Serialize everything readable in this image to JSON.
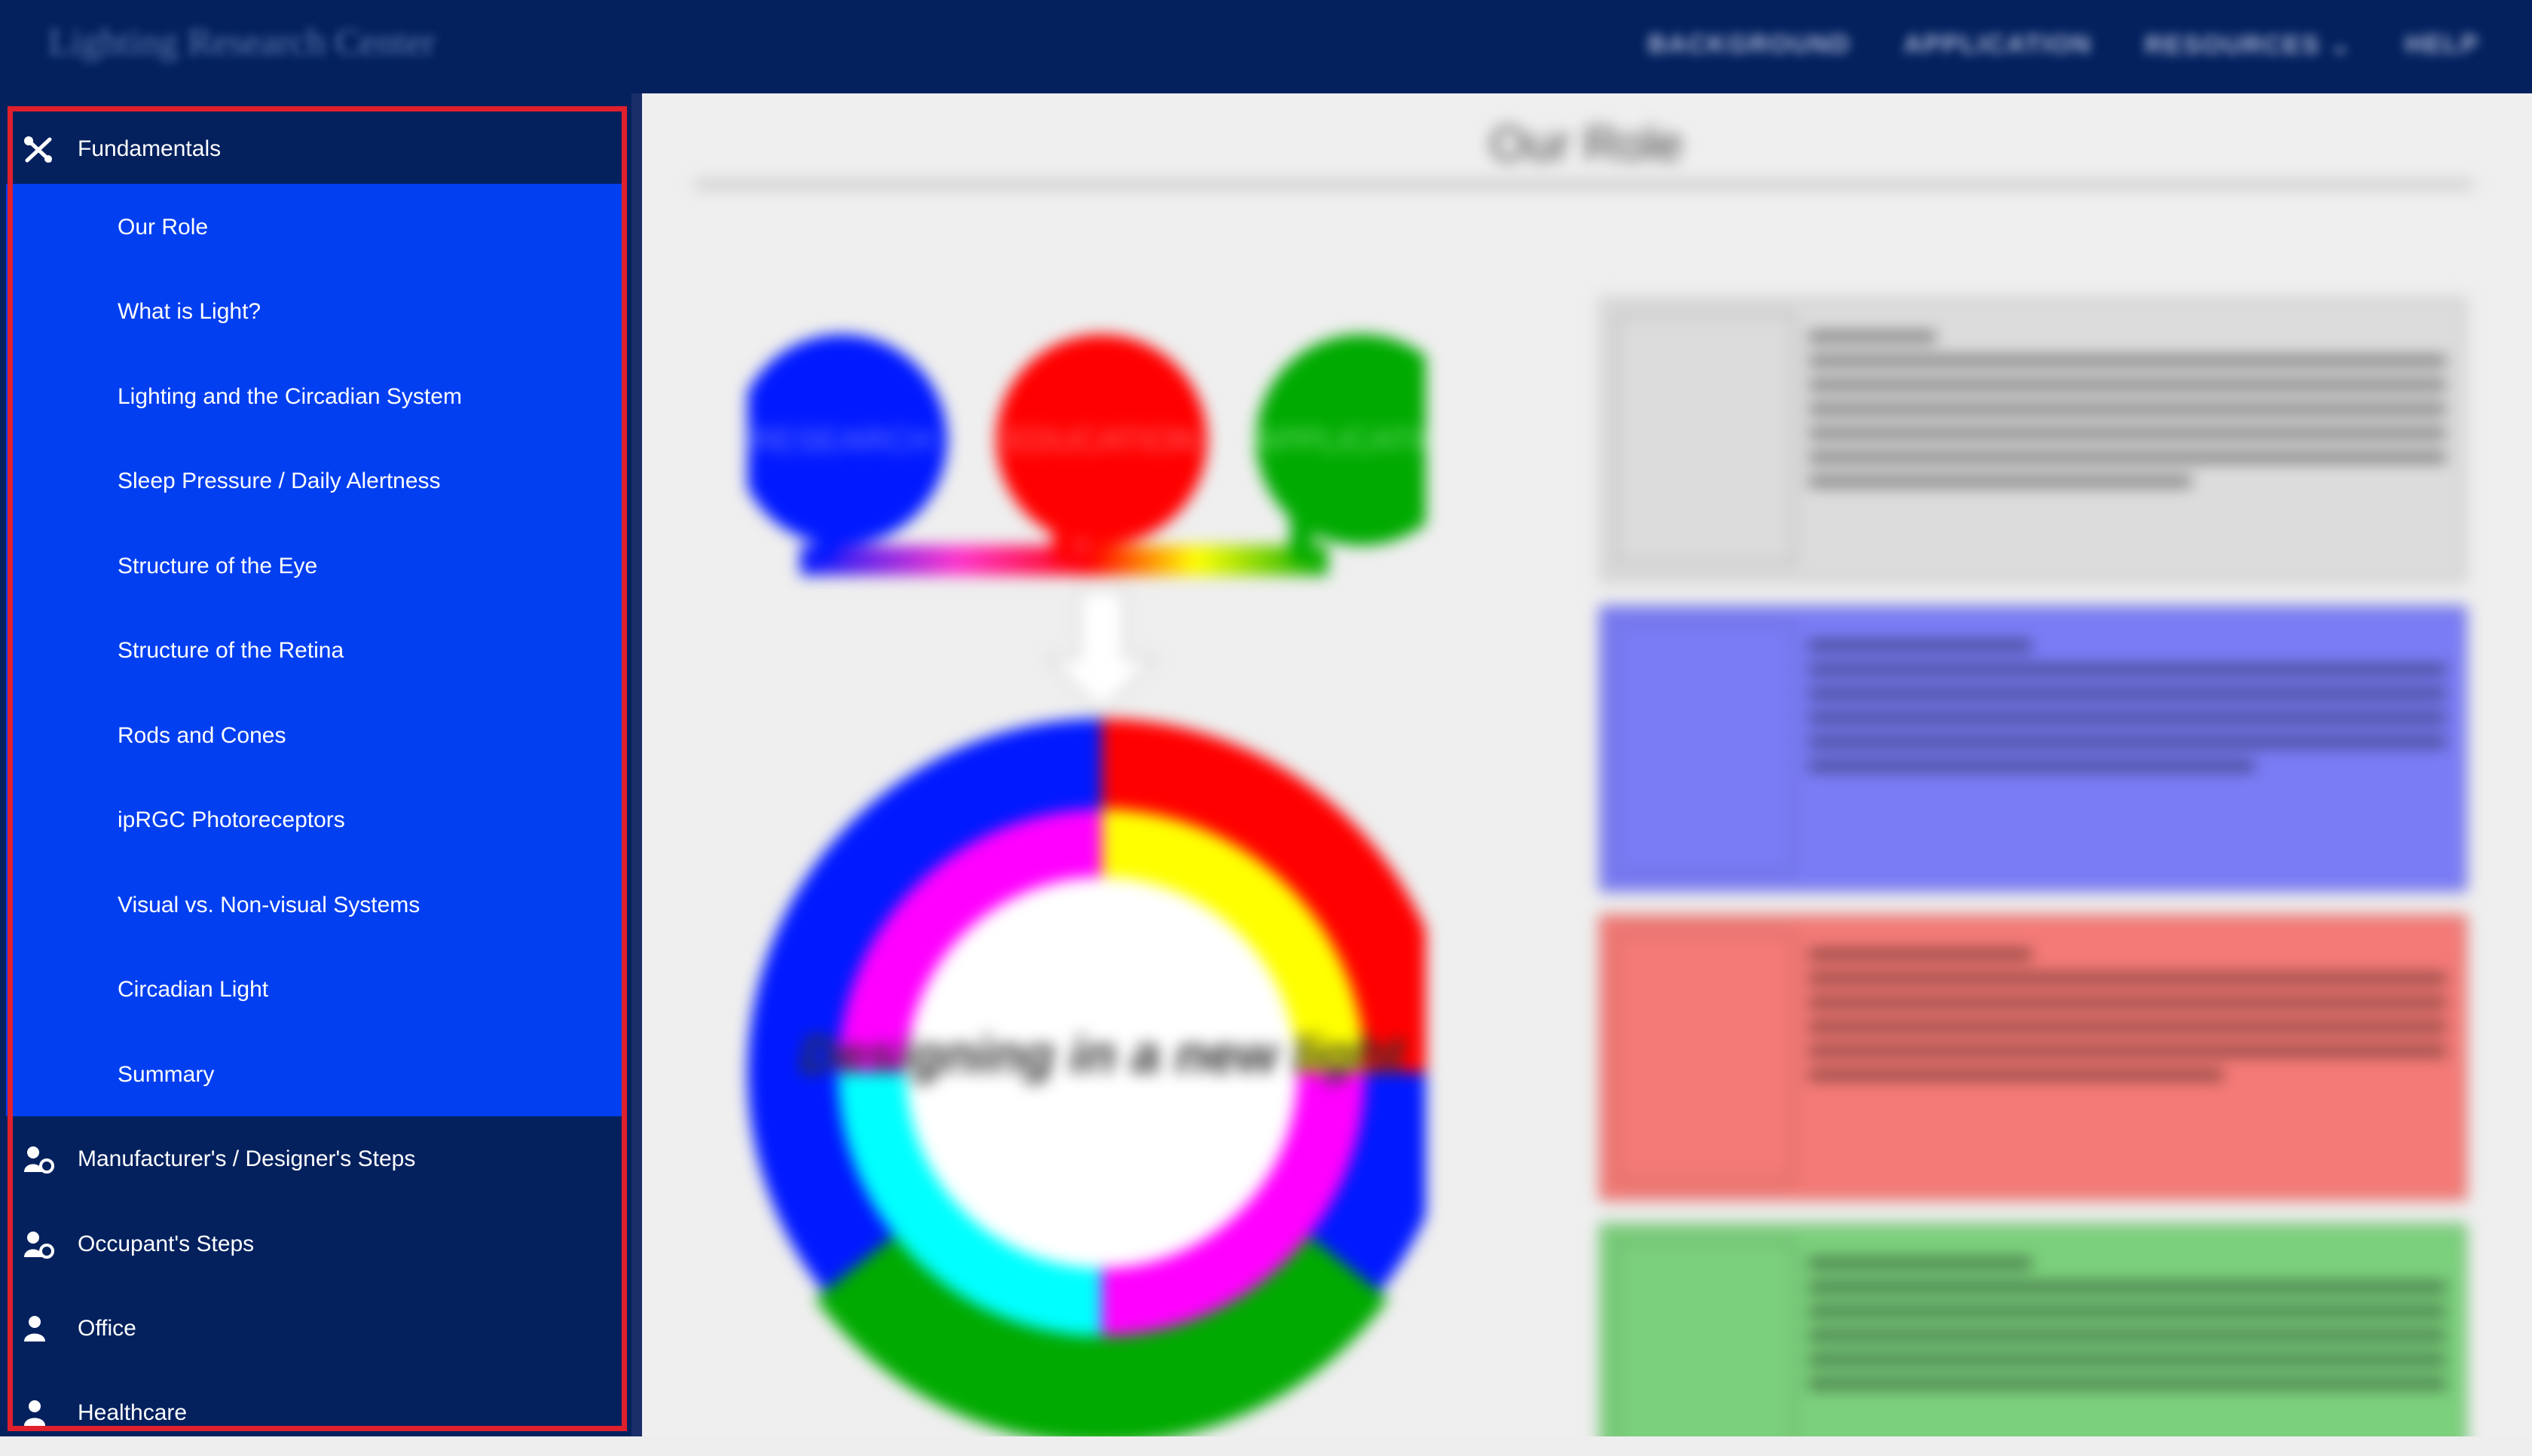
{
  "header": {
    "brand": "Lighting Research Center",
    "nav": [
      "BACKGROUND",
      "APPLICATION",
      "RESOURCES ⌄",
      "HELP"
    ]
  },
  "sidebar": {
    "sections": [
      {
        "label": "Fundamentals",
        "icon": "tools-icon"
      },
      {
        "label": "Manufacturer's / Designer's Steps",
        "icon": "user-settings-icon"
      },
      {
        "label": "Occupant's Steps",
        "icon": "user-settings-icon"
      },
      {
        "label": "Office",
        "icon": "user-icon"
      },
      {
        "label": "Healthcare",
        "icon": "user-icon"
      }
    ],
    "fundamentals_items": [
      "Our Role",
      "What is Light?",
      "Lighting and the Circadian System",
      "Sleep Pressure / Daily Alertness",
      "Structure of the Eye",
      "Structure of the Retina",
      "Rods and Cones",
      "ipRGC Photoreceptors",
      "Visual vs. Non-visual Systems",
      "Circadian Light",
      "Summary"
    ]
  },
  "main": {
    "title": "Our Role",
    "circles": [
      "RESEARCH",
      "EDUCATION",
      "APPLICATION"
    ],
    "ring_center_text": "Designing in a new light",
    "cards": [
      {
        "heading": "Our role",
        "color": "#dcdcdc"
      },
      {
        "heading": "Research at",
        "color": "#7a7cf6"
      },
      {
        "heading": "Education at",
        "color": "#f47a76"
      },
      {
        "heading": "Application guidelines for",
        "color": "#7bd07c"
      }
    ]
  },
  "colors": {
    "topbar": "#04215e",
    "sidebar": "#04215e",
    "submenu": "#023ff0",
    "highlight": "#e0202c"
  }
}
